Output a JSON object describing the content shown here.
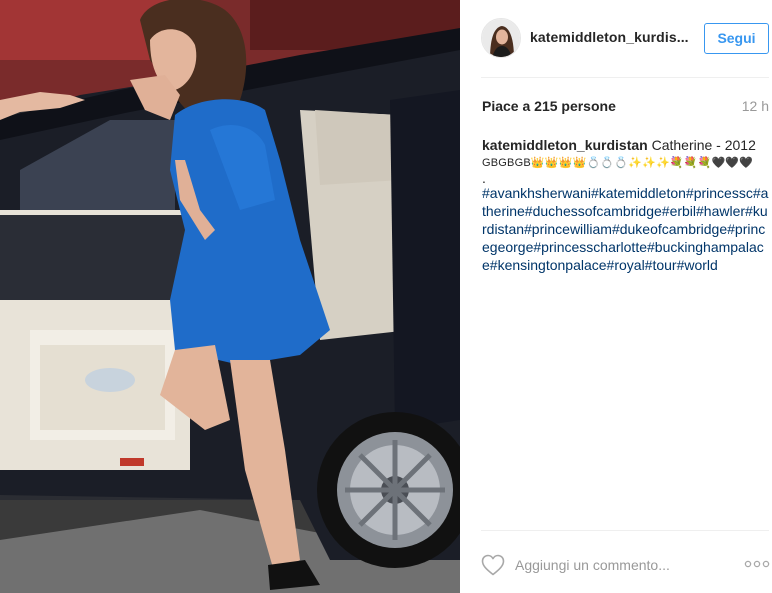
{
  "post": {
    "username": "katemiddleton_kurdis...",
    "follow_label": "Segui",
    "likes_text": "Piace a 215 persone",
    "time_ago": "12 h"
  },
  "caption": {
    "username": "katemiddleton_kurdistan",
    "text": "Catherine - 2012",
    "emoji_line": "GBGBGB👑👑👑👑💍💍💍✨✨✨💐💐💐🖤🖤🖤",
    "dot": ".",
    "hashtags": "#avankhsherwani#katemiddleton#princessc#atherine#duchessofcambridge#erbil#hawler#kurdistan#princewilliam#dukeofcambridge#princegeorge#princesscharlotte#buckinghampalace#kensingtonpalace#royal#tour#world"
  },
  "comment": {
    "placeholder": "Aggiungi un commento...",
    "more_label": "ooo"
  },
  "colors": {
    "accent": "#3897f0",
    "hashtag": "#003569",
    "muted": "#999999",
    "text": "#262626"
  },
  "icons": {
    "like": "heart-outline-icon",
    "more": "more-options-icon"
  }
}
